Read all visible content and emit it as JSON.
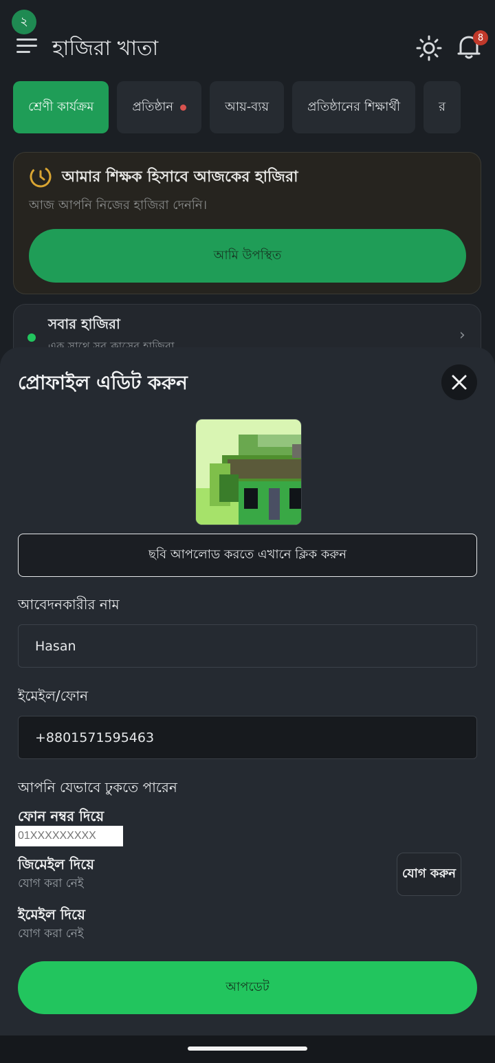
{
  "status": {
    "badge": "২"
  },
  "header": {
    "title": "হাজিরা খাতা",
    "notification_count": "8"
  },
  "tabs": [
    {
      "label": "শ্রেণী কার্যক্রম",
      "active": true
    },
    {
      "label": "প্রতিষ্ঠান",
      "dot": true
    },
    {
      "label": "আয়-ব্যয়"
    },
    {
      "label": "প্রতিষ্ঠানের শিক্ষার্থী"
    },
    {
      "label": "র"
    }
  ],
  "attendance_card": {
    "title": "আমার শিক্ষক হিসাবে আজকের হাজিরা",
    "subtitle": "আজ আপনি নিজের হাজিরা দেননি।",
    "button_label": "আমি উপস্থিত"
  },
  "all_attendance": {
    "title": "সবার হাজিরা",
    "subtitle": "এক সাথে সব ক্লাসের হাজিরা"
  },
  "profile_sheet": {
    "title": "প্রোফাইল এডিট করুন",
    "upload_label": "ছবি আপলোড করতে এখানে ক্লিক করুন",
    "name_label": "আবেদনকারীর নাম",
    "name_value": "Hasan",
    "contact_label": "ইমেইল/ফোন",
    "contact_value": "+8801571595463",
    "login_methods_label": "আপনি যেভাবে ঢুকতে পারেন",
    "phone_method_label": "ফোন নম্বর দিয়ে",
    "phone_placeholder": "01XXXXXXXXX",
    "gmail_method_label": "জিমেইল দিয়ে",
    "gmail_status": "যোগ করা নেই",
    "add_button_label": "যোগ করুন",
    "email_method_label": "ইমেইল দিয়ে",
    "email_status": "যোগ করা নেই",
    "update_button_label": "আপডেট"
  },
  "colors": {
    "accent_green": "#22c55e",
    "dark_green": "#1f9d57",
    "background": "#1b1f24",
    "sheet": "#252a31"
  }
}
